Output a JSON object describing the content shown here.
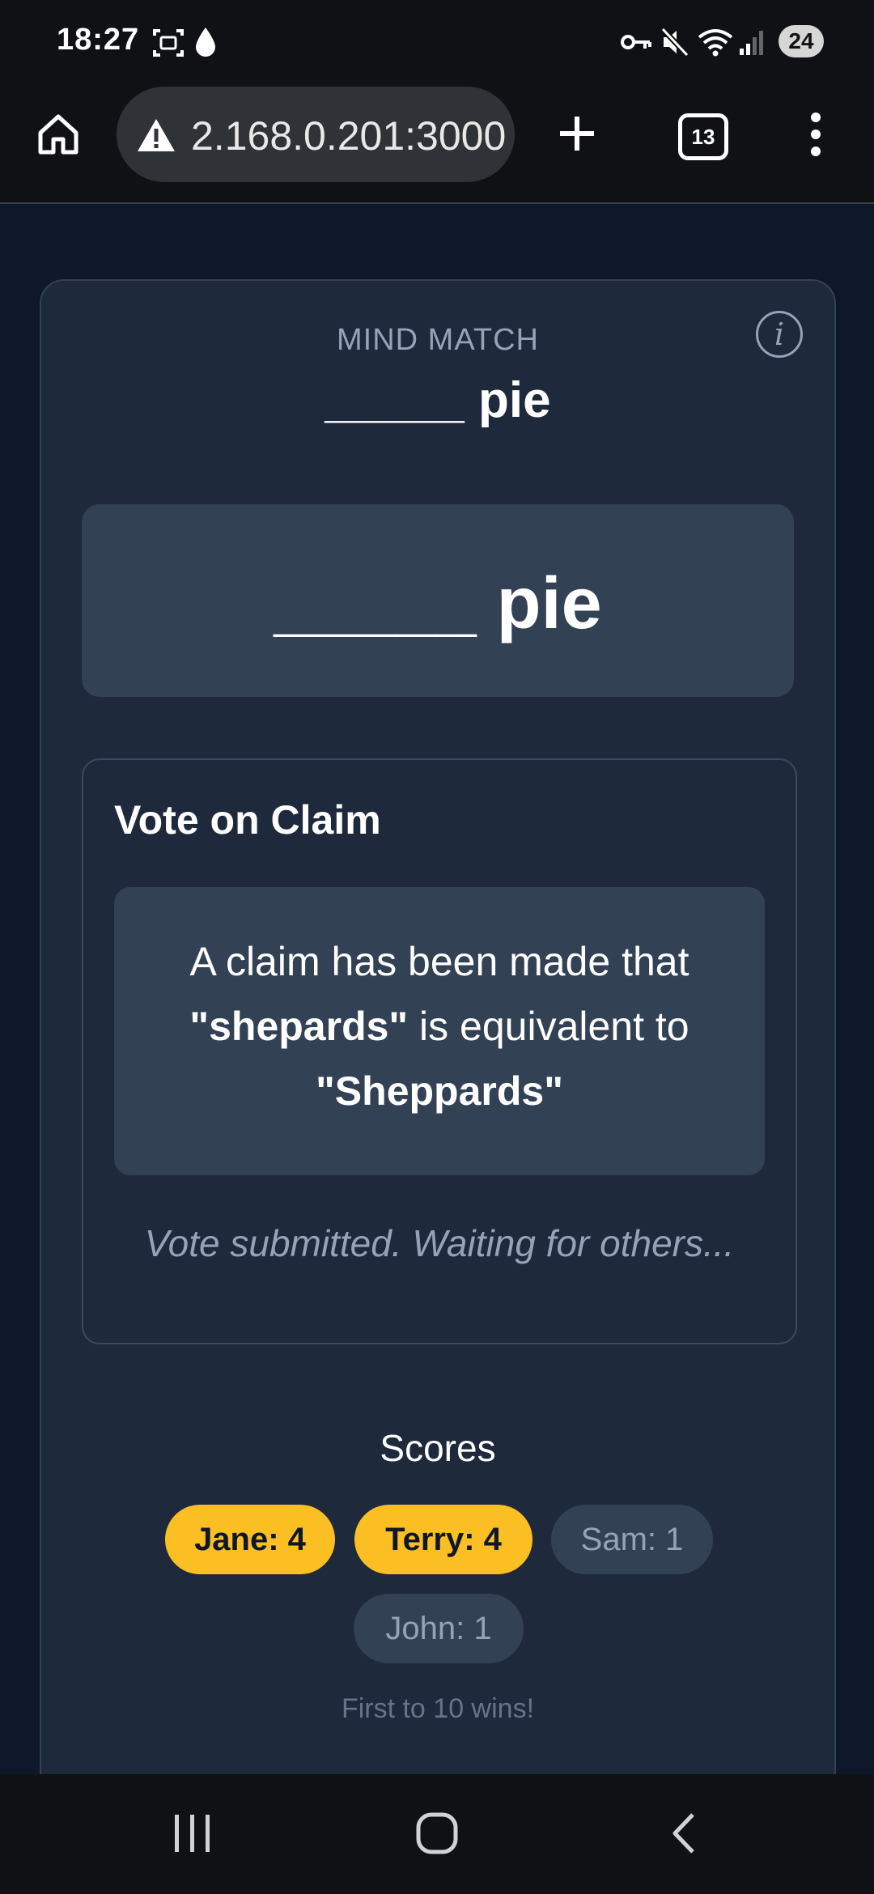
{
  "status_bar": {
    "time": "18:27",
    "battery": "24",
    "icons": [
      "screenshot-icon",
      "water-drop-icon",
      "vpn-key-icon",
      "mute-icon",
      "wifi-icon",
      "signal-icon"
    ]
  },
  "browser": {
    "url": "2.168.0.201:3000",
    "tab_count": "13",
    "icons": [
      "home-icon",
      "warning-icon",
      "new-tab-icon",
      "tabs-icon",
      "menu-icon"
    ]
  },
  "game": {
    "name": "MIND MATCH",
    "prompt_blank": "_____",
    "prompt_word": "pie",
    "info_glyph": "i"
  },
  "vote": {
    "title": "Vote on Claim",
    "claim_prefix": "A claim has been made that ",
    "claim_a": "\"shepards\"",
    "claim_middle": " is equivalent to ",
    "claim_b": "\"Sheppards\"",
    "status": "Vote submitted. Waiting for others..."
  },
  "scores": {
    "title": "Scores",
    "players": [
      {
        "label": "Jane: 4",
        "leading": true
      },
      {
        "label": "Terry: 4",
        "leading": true
      },
      {
        "label": "Sam: 1",
        "leading": false
      },
      {
        "label": "John: 1",
        "leading": false
      }
    ],
    "rule": "First to 10 wins!"
  },
  "colors": {
    "page_bg": "#0f172a",
    "card_bg": "#1e293b",
    "panel_bg": "#334155",
    "accent": "#fbbf24",
    "muted_text": "#94a3b8"
  }
}
